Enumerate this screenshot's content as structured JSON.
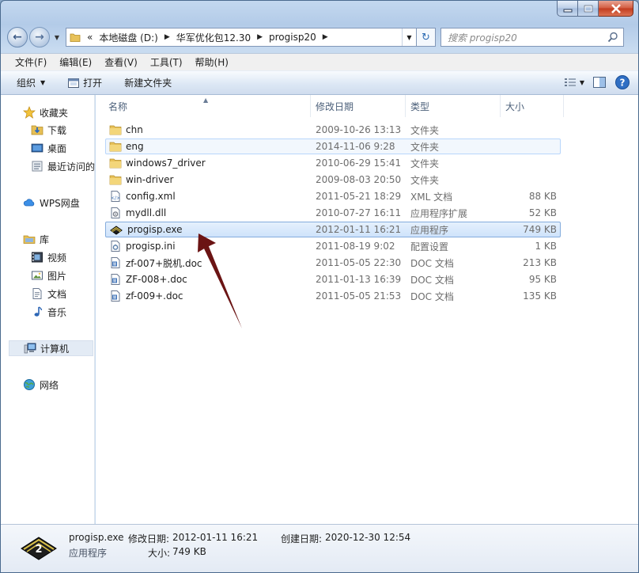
{
  "window": {
    "title_blurred": ""
  },
  "address": {
    "crumbs": [
      "本地磁盘 (D:)",
      "华军优化包12.30",
      "progisp20"
    ],
    "overflow": "«"
  },
  "search": {
    "placeholder": "搜索 progisp20"
  },
  "menu": [
    "文件(F)",
    "编辑(E)",
    "查看(V)",
    "工具(T)",
    "帮助(H)"
  ],
  "commands": {
    "organize": "组织",
    "open": "打开",
    "new_folder": "新建文件夹"
  },
  "nav": {
    "favorites": "收藏夹",
    "downloads": "下载",
    "desktop": "桌面",
    "recent": "最近访问的",
    "wps": "WPS网盘",
    "libraries": "库",
    "videos": "视频",
    "pictures": "图片",
    "documents": "文档",
    "music": "音乐",
    "computer": "计算机",
    "network": "网络"
  },
  "columns": {
    "name": "名称",
    "date": "修改日期",
    "type": "类型",
    "size": "大小"
  },
  "files": [
    {
      "name": "chn",
      "date": "2009-10-26 13:13",
      "type": "文件夹",
      "size": "",
      "icon": "folder-icon"
    },
    {
      "name": "eng",
      "date": "2014-11-06 9:28",
      "type": "文件夹",
      "size": "",
      "icon": "folder-icon"
    },
    {
      "name": "windows7_driver",
      "date": "2010-06-29 15:41",
      "type": "文件夹",
      "size": "",
      "icon": "folder-icon"
    },
    {
      "name": "win-driver",
      "date": "2009-08-03 20:50",
      "type": "文件夹",
      "size": "",
      "icon": "folder-icon"
    },
    {
      "name": "config.xml",
      "date": "2011-05-21 18:29",
      "type": "XML 文档",
      "size": "88 KB",
      "icon": "xml-file-icon"
    },
    {
      "name": "mydll.dll",
      "date": "2010-07-27 16:11",
      "type": "应用程序扩展",
      "size": "52 KB",
      "icon": "dll-file-icon"
    },
    {
      "name": "progisp.exe",
      "date": "2012-01-11 16:21",
      "type": "应用程序",
      "size": "749 KB",
      "icon": "chip-exe-icon"
    },
    {
      "name": "progisp.ini",
      "date": "2011-08-19 9:02",
      "type": "配置设置",
      "size": "1 KB",
      "icon": "ini-file-icon"
    },
    {
      "name": "zf-007+脱机.doc",
      "date": "2011-05-05 22:30",
      "type": "DOC 文档",
      "size": "213 KB",
      "icon": "doc-file-icon"
    },
    {
      "name": "ZF-008+.doc",
      "date": "2011-01-13 16:39",
      "type": "DOC 文档",
      "size": "95 KB",
      "icon": "doc-file-icon"
    },
    {
      "name": "zf-009+.doc",
      "date": "2011-05-05 21:53",
      "type": "DOC 文档",
      "size": "135 KB",
      "icon": "doc-file-icon"
    }
  ],
  "details": {
    "name": "progisp.exe",
    "type": "应用程序",
    "modified_label": "修改日期:",
    "modified": "2012-01-11 16:21",
    "created_label": "创建日期:",
    "created": "2020-12-30 12:54",
    "size_label": "大小:",
    "size": "749 KB"
  },
  "colors": {
    "selection": "#cfe3fb",
    "annotation_arrow": "#6b1414",
    "close_button": "#c23b1e"
  }
}
